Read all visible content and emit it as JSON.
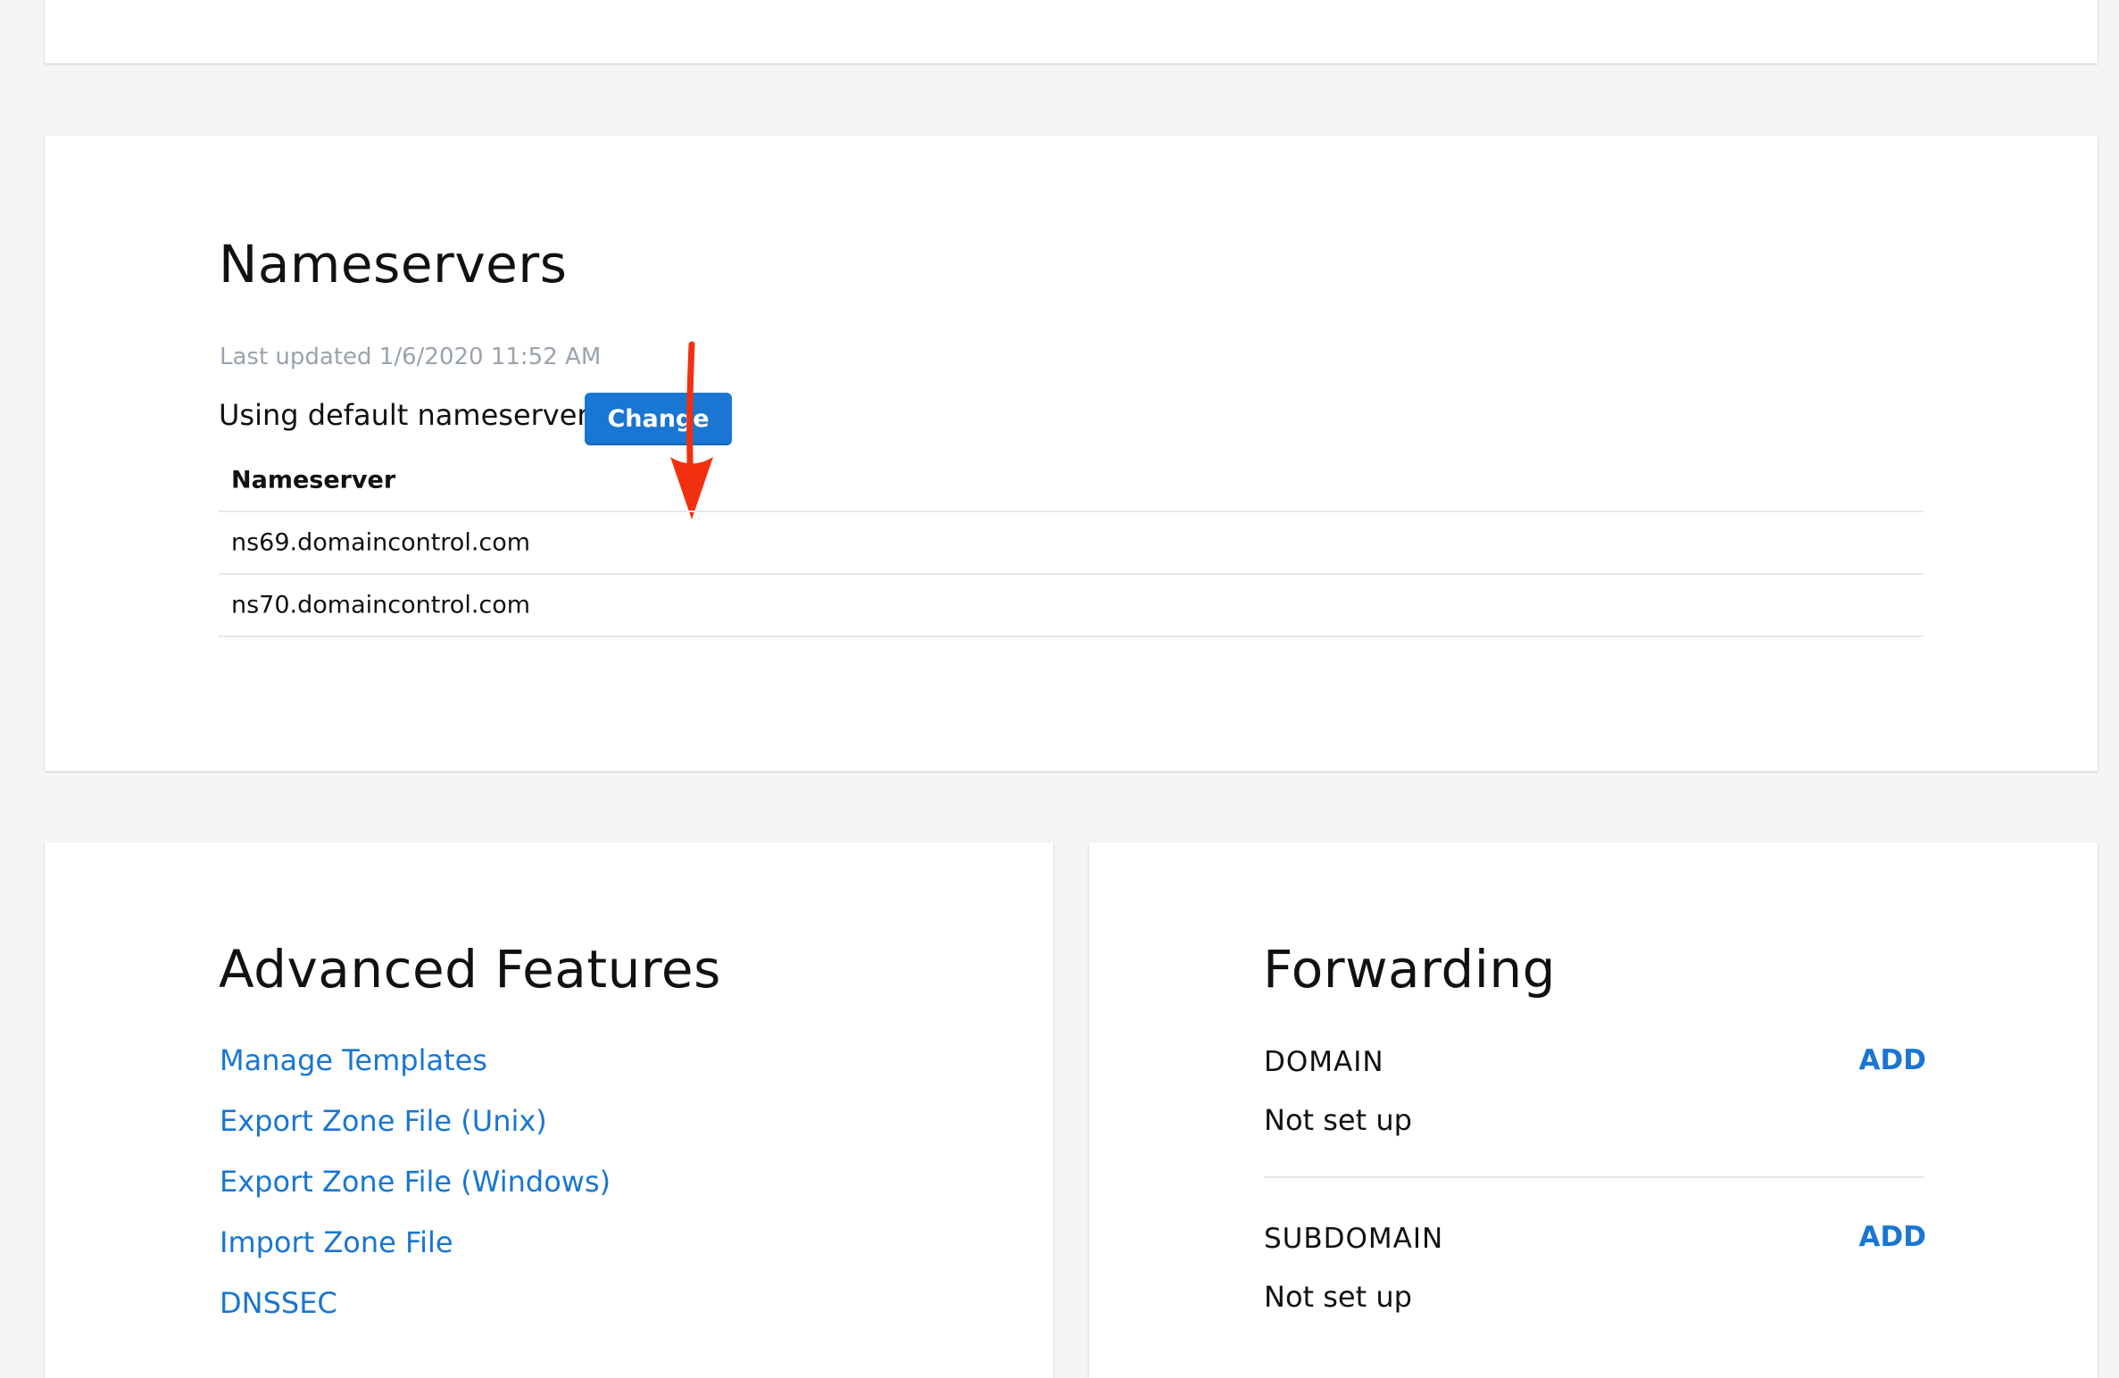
{
  "nameservers": {
    "title": "Nameservers",
    "last_updated": "Last updated 1/6/2020 11:52 AM",
    "status": "Using default nameservers",
    "change_label": "Change",
    "table_header": "Nameserver",
    "rows": [
      "ns69.domaincontrol.com",
      "ns70.domaincontrol.com"
    ]
  },
  "annotation": {
    "arrow_color": "#f2300f",
    "icon": "red-arrow-down-icon"
  },
  "advanced": {
    "title": "Advanced Features",
    "links": [
      "Manage Templates",
      "Export Zone File (Unix)",
      "Export Zone File (Windows)",
      "Import Zone File",
      "DNSSEC"
    ]
  },
  "forwarding": {
    "title": "Forwarding",
    "items": [
      {
        "label": "DOMAIN",
        "add": "ADD",
        "status": "Not set up"
      },
      {
        "label": "SUBDOMAIN",
        "add": "ADD",
        "status": "Not set up"
      }
    ]
  },
  "colors": {
    "accent": "#1976d2",
    "background": "#f4f5f7",
    "muted_text": "#9aa3ad"
  }
}
